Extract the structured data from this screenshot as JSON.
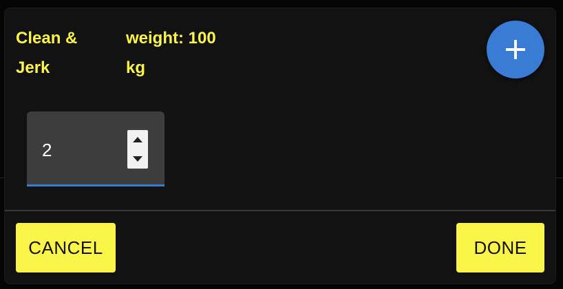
{
  "dialog": {
    "exercise_name": "Clean &\nJerk",
    "weight_label": "weight: 100\nkg",
    "add_button_icon": "plus-icon",
    "input": {
      "value": "2",
      "stepper_up_icon": "triangle-up-icon",
      "stepper_down_icon": "triangle-down-icon"
    },
    "actions": {
      "cancel_label": "CANCEL",
      "done_label": "DONE"
    }
  },
  "colors": {
    "accent_yellow": "#fbf54a",
    "accent_blue": "#3a7bd5",
    "dialog_background": "#121212",
    "input_background": "#3d3d3d"
  }
}
